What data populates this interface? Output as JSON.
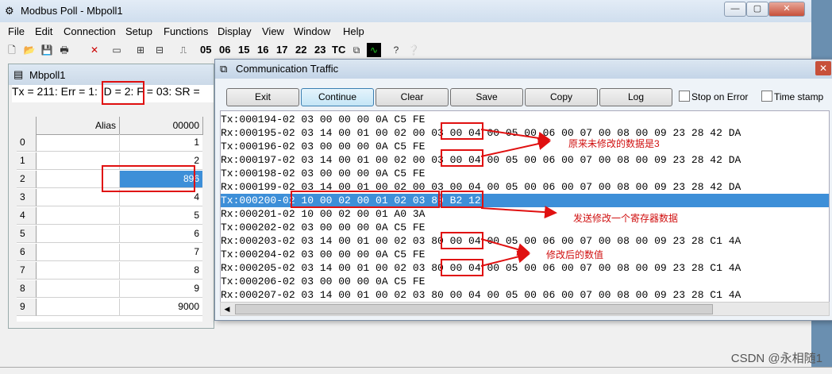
{
  "app": {
    "title": "Modbus Poll - Mbpoll1"
  },
  "menu": [
    "File",
    "Edit",
    "Connection",
    "Setup",
    "Functions",
    "Display",
    "View",
    "Window",
    "Help"
  ],
  "toolbar": {
    "func_codes": [
      "05",
      "06",
      "15",
      "16",
      "17",
      "22",
      "23"
    ],
    "tc_label": "TC"
  },
  "mdi": {
    "title": "Mbpoll1",
    "status": "Tx = 211: Err = 1: ID = 2: F = 03: SR =",
    "col_alias": "Alias",
    "col_value": "00000",
    "rows": [
      {
        "idx": "0",
        "value": "1"
      },
      {
        "idx": "1",
        "value": "2"
      },
      {
        "idx": "2",
        "value": "896"
      },
      {
        "idx": "3",
        "value": "4"
      },
      {
        "idx": "4",
        "value": "5"
      },
      {
        "idx": "5",
        "value": "6"
      },
      {
        "idx": "6",
        "value": "7"
      },
      {
        "idx": "7",
        "value": "8"
      },
      {
        "idx": "8",
        "value": "9"
      },
      {
        "idx": "9",
        "value": "9000"
      }
    ],
    "selected_row": 2
  },
  "dialog": {
    "title": "Communication Traffic",
    "buttons": {
      "exit": "Exit",
      "continue": "Continue",
      "clear": "Clear",
      "save": "Save",
      "copy": "Copy",
      "log": "Log"
    },
    "stop_on_error": "Stop on Error",
    "time_stamp": "Time stamp",
    "lines": [
      "Tx:000194-02 03 00 00 00 0A C5 FE",
      "Rx:000195-02 03 14 00 01 00 02 00 03 00 04 00 05 00 06 00 07 00 08 00 09 23 28 42 DA",
      "Tx:000196-02 03 00 00 00 0A C5 FE",
      "Rx:000197-02 03 14 00 01 00 02 00 03 00 04 00 05 00 06 00 07 00 08 00 09 23 28 42 DA",
      "Tx:000198-02 03 00 00 00 0A C5 FE",
      "Rx:000199-02 03 14 00 01 00 02 00 03 00 04 00 05 00 06 00 07 00 08 00 09 23 28 42 DA",
      "Tx:000200-02 10 00 02 00 01 02 03 80 B2 12",
      "Rx:000201-02 10 00 02 00 01 A0 3A",
      "Tx:000202-02 03 00 00 00 0A C5 FE",
      "Rx:000203-02 03 14 00 01 00 02 03 80 00 04 00 05 00 06 00 07 00 08 00 09 23 28 C1 4A",
      "Tx:000204-02 03 00 00 00 0A C5 FE",
      "Rx:000205-02 03 14 00 01 00 02 03 80 00 04 00 05 00 06 00 07 00 08 00 09 23 28 C1 4A",
      "Tx:000206-02 03 00 00 00 0A C5 FE",
      "Rx:000207-02 03 14 00 01 00 02 03 80 00 04 00 05 00 06 00 07 00 08 00 09 23 28 C1 4A"
    ],
    "selected_line": 6
  },
  "annotations": {
    "a1": "原来未修改的数据是3",
    "a2": "发送修改一个寄存器数据",
    "a3": "修改后的数值"
  },
  "watermark": "CSDN @永相随1"
}
